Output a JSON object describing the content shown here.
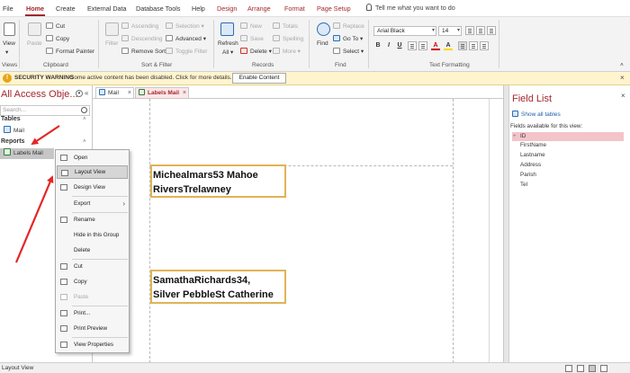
{
  "tabs": {
    "file": "File",
    "home": "Home",
    "create": "Create",
    "external_data": "External Data",
    "database_tools": "Database Tools",
    "help": "Help",
    "design": "Design",
    "arrange": "Arrange",
    "format": "Format",
    "page_setup": "Page Setup",
    "tell_me": "Tell me what you want to do"
  },
  "ribbon": {
    "views": {
      "view_label": "View",
      "group": "Views"
    },
    "clipboard": {
      "paste": "Paste",
      "cut": "Cut",
      "copy": "Copy",
      "format_painter": "Format Painter",
      "group": "Clipboard"
    },
    "sort_filter": {
      "filter": "Filter",
      "ascending": "Ascending",
      "descending": "Descending",
      "remove_sort": "Remove Sort",
      "selection": "Selection",
      "advanced": "Advanced",
      "toggle_filter": "Toggle Filter",
      "group": "Sort & Filter"
    },
    "records": {
      "refresh": "Refresh",
      "refresh_all": "All",
      "new": "New",
      "save": "Save",
      "delete": "Delete",
      "totals": "Totals",
      "spelling": "Spelling",
      "more": "More",
      "group": "Records"
    },
    "find": {
      "find": "Find",
      "replace": "Replace",
      "goto": "Go To",
      "select": "Select",
      "group": "Find"
    },
    "text_formatting": {
      "font": "Arial Black",
      "size": "14",
      "bold": "B",
      "italic": "I",
      "underline": "U",
      "font_color": "A",
      "highlight": "A",
      "group": "Text Formatting"
    }
  },
  "security_bar": {
    "title": "SECURITY WARNING",
    "message": "Some active content has been disabled. Click for more details.",
    "button": "Enable Content",
    "close": "×"
  },
  "nav": {
    "title": "All Access Obje...",
    "search_placeholder": "Search...",
    "collapse": "«",
    "tables_header": "Tables",
    "tables": [
      "Mail"
    ],
    "reports_header": "Reports",
    "reports": [
      "Labels Mail"
    ],
    "chevron": "»"
  },
  "document": {
    "tab_mail": "Mail",
    "tab_labels": "Labels Mail",
    "tab_close": "×",
    "label1": {
      "line1": "Michealmars53 Mahoe",
      "line2": "RiversTrelawney"
    },
    "label2": {
      "line1": "SamathaRichards34,",
      "line2": "Silver PebbleSt Catherine"
    }
  },
  "context_menu": {
    "items": [
      "Open",
      "Layout View",
      "Design View",
      "Export",
      "Rename",
      "Hide in this Group",
      "Delete",
      "Cut",
      "Copy",
      "Paste",
      "Print...",
      "Print Preview",
      "View Properties"
    ],
    "submenu_arrow": "›"
  },
  "field_list": {
    "title": "Field List",
    "close": "×",
    "show_all": "Show all tables",
    "available_label": "Fields available for this view:",
    "fields": [
      "ID",
      "FirstName",
      "Lastname",
      "Address",
      "Parish",
      "Tel"
    ],
    "expand": "+"
  },
  "status_bar": {
    "text": "Layout View"
  },
  "colors": {
    "accent": "#a4262c",
    "warning_bg": "#fff4ce",
    "label_border": "#e0b356",
    "arrow": "#e32626",
    "field_selected": "#f3c4c9"
  },
  "icons": [
    "lightbulb-icon",
    "view-icon",
    "paste-icon",
    "cut-icon",
    "copy-icon",
    "format-painter-icon",
    "filter-icon",
    "refresh-icon",
    "find-icon",
    "shield-icon",
    "search-icon",
    "table-icon",
    "report-icon",
    "close-icon"
  ]
}
